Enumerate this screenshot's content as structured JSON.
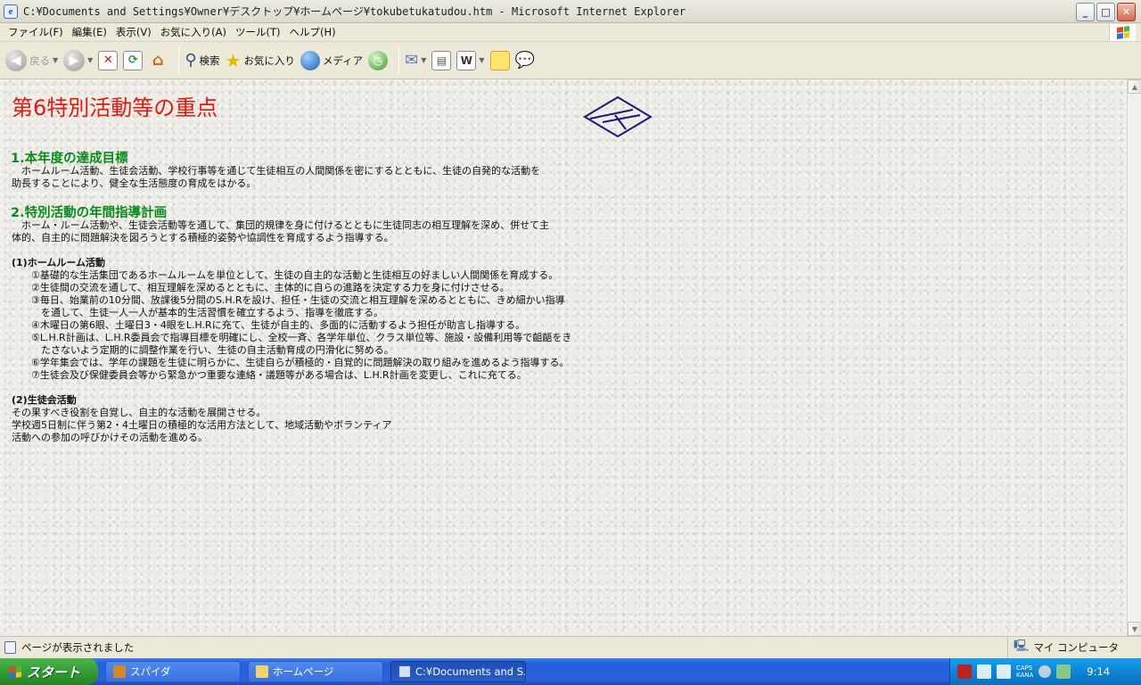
{
  "window": {
    "title": "C:¥Documents and Settings¥Owner¥デスクトップ¥ホームページ¥tokubetukatudou.htm - Microsoft Internet Explorer",
    "minimize": "_",
    "maximize": "□",
    "close": "✕"
  },
  "menu": [
    "ファイル(F)",
    "編集(E)",
    "表示(V)",
    "お気に入り(A)",
    "ツール(T)",
    "ヘルプ(H)"
  ],
  "toolbar": {
    "back_label": "戻る",
    "search_label": "検索",
    "favorites_label": "お気に入り",
    "media_label": "メディア"
  },
  "page": {
    "title": "第6特別活動等の重点",
    "section1": {
      "heading": "1.本年度の達成目標",
      "lines": [
        "　ホームルーム活動、生徒会活動、学校行事等を通じて生徒相互の人間関係を密にするとともに、生徒の自発的な活動を",
        "助長することにより、健全な生活態度の育成をはかる。"
      ]
    },
    "section2": {
      "heading": "2.特別活動の年間指導計画",
      "lines": [
        "　ホーム・ルーム活動や、生徒会活動等を通して、集団的規律を身に付けるとともに生徒同志の相互理解を深め、併せて主",
        "体的、自主的に問題解決を図ろうとする積極的姿勢や協調性を育成するよう指導する。"
      ]
    },
    "sub1": {
      "heading": "(1)ホームルーム活動",
      "lines": [
        "　　①基礎的な生活集団であるホームルームを単位として、生徒の自主的な活動と生徒相互の好ましい人間関係を育成する。",
        "　　②生徒間の交流を通して、相互理解を深めるとともに、主体的に自らの進路を決定する力を身に付けさせる。",
        "　　③毎日、始業前の10分間、放課後5分間のS.H.Rを設け、担任・生徒の交流と相互理解を深めるとともに、きめ細かい指導",
        "　　　を通して、生徒一人一人が基本的生活習慣を確立するよう、指導を徹底する。",
        "　　④木曜日の第6眼、土曜日3・4眼をL.H.Rに充て、生徒が自主的、多面的に活動するよう担任が助言し指導する。",
        "　　⑤L.H.R計画は、L.H.R委員会で指導目標を明確にし、全校一斉、各学年単位、クラス単位等、施設・設備利用等で齟齬をき",
        "　　　たさないよう定期的に調整作業を行い、生徒の自主活動育成の円滑化に努める。",
        "　　⑥学年集会では、学年の課題を生徒に明らかに、生徒自らが積極的・自覚的に問題解決の取り組みを進めるよう指導する。",
        "　　⑦生徒会及び保健委員会等から緊急かつ重要な連絡・議題等がある場合は、L.H.R計画を変更し、これに充てる。"
      ]
    },
    "sub2": {
      "heading": "(2)生徒会活動",
      "lines": [
        "その果すべき役割を自覚し、自主的な活動を展開させる。",
        "学校週5日制に伴う第2・4土曜日の積極的な活用方法として、地域活動やボランティア",
        "活動への参加の呼びかけその活動を進める。"
      ]
    }
  },
  "status": {
    "text": "ページが表示されました",
    "zone": "マイ コンピュータ"
  },
  "taskbar": {
    "start": "スタート",
    "tasks": [
      "スパイダ",
      "ホームページ",
      "C:¥Documents and S..."
    ],
    "caps": "CAPS",
    "kana": "KANA",
    "clock": "9:14"
  }
}
